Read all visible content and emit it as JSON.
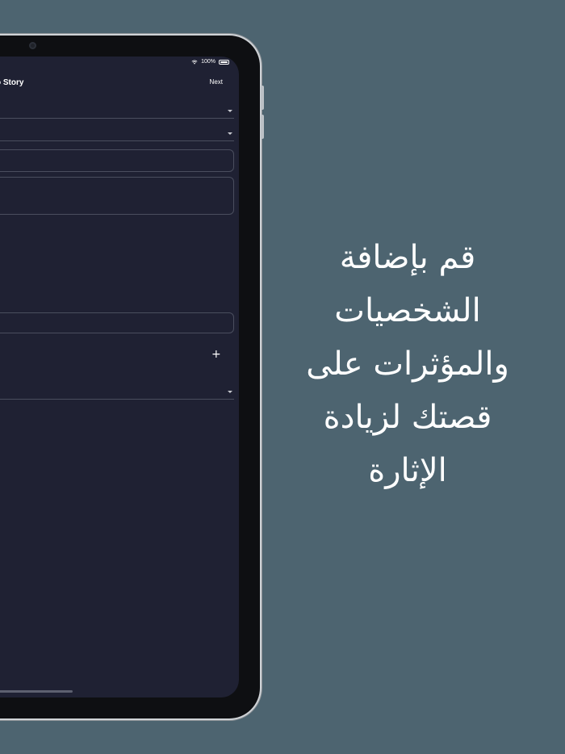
{
  "status_bar": {
    "battery_text": "100%",
    "icons": [
      "wifi-icon",
      "battery-icon"
    ]
  },
  "nav": {
    "title": "o Story",
    "next_label": "Next"
  },
  "form": {
    "add_label": "+"
  },
  "promo": {
    "lines": [
      "قم بإضافة",
      "الشخصيات",
      "والمؤثرات على",
      "قصتك لزيادة",
      "الإثارة"
    ]
  },
  "colors": {
    "background": "#4d6470",
    "screen": "#1f2133",
    "field_border": "#4a4e5e",
    "text": "#ffffff"
  }
}
